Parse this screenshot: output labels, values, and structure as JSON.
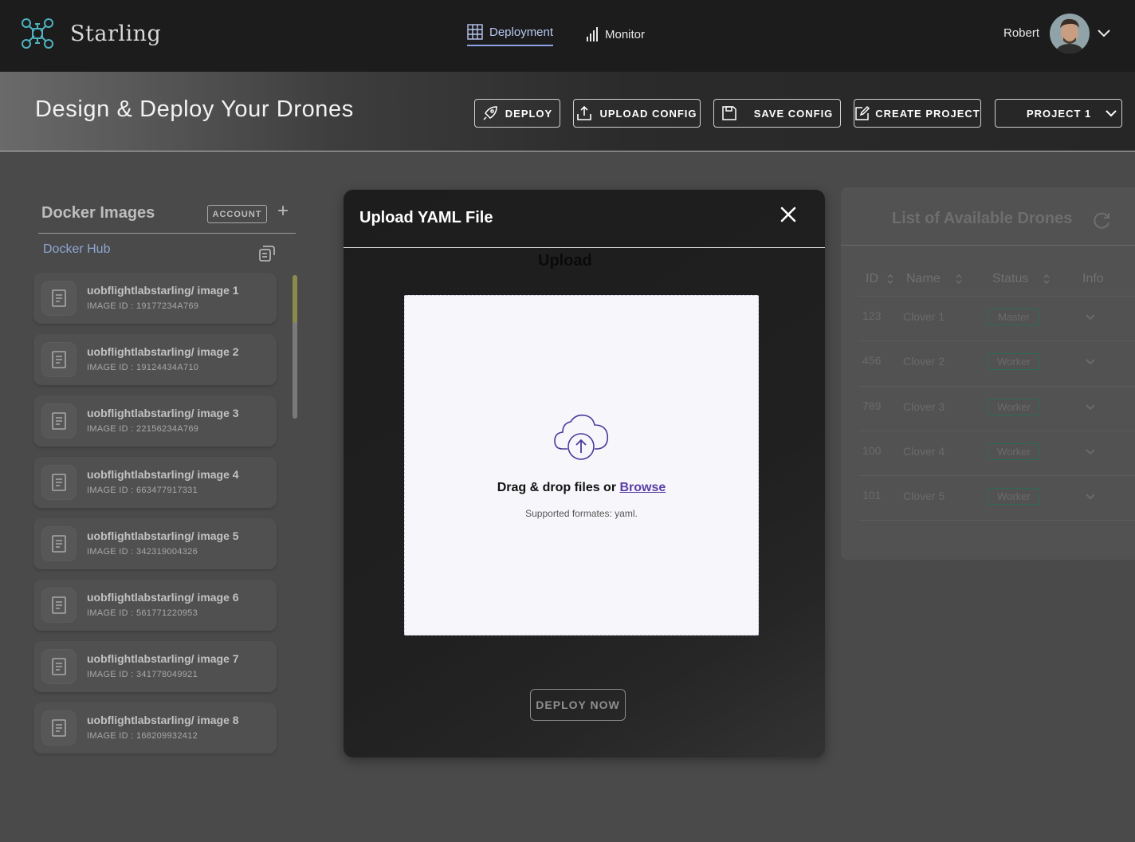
{
  "app": {
    "brand": "Starling"
  },
  "nav": {
    "deployment": "Deployment",
    "monitor": "Monitor"
  },
  "user": {
    "name": "Robert"
  },
  "header": {
    "title": "Design & Deploy Your Drones",
    "deploy": "DEPLOY",
    "upload_config": "UPLOAD CONFIG",
    "save_config": "SAVE CONFIG",
    "create_project": "CREATE PROJECT",
    "project_select": "PROJECT 1"
  },
  "docker": {
    "title": "Docker Images",
    "account": "ACCOUNT",
    "hub": "Docker Hub",
    "images": [
      {
        "name": "uobflightlabstarling/ image 1",
        "id": "IMAGE ID : 19177234A769"
      },
      {
        "name": "uobflightlabstarling/ image 2",
        "id": "IMAGE ID : 19124434A710"
      },
      {
        "name": "uobflightlabstarling/ image 3",
        "id": "IMAGE ID : 22156234A769"
      },
      {
        "name": "uobflightlabstarling/ image 4",
        "id": "IMAGE ID : 663477917331"
      },
      {
        "name": "uobflightlabstarling/ image 5",
        "id": "IMAGE ID : 342319004326"
      },
      {
        "name": "uobflightlabstarling/ image 6",
        "id": "IMAGE ID : 561771220953"
      },
      {
        "name": "uobflightlabstarling/ image 7",
        "id": "IMAGE ID : 341778049921"
      },
      {
        "name": "uobflightlabstarling/ image 8",
        "id": "IMAGE ID : 168209932412"
      }
    ]
  },
  "drones": {
    "title": "List of Available Drones",
    "columns": {
      "id": "ID",
      "name": "Name",
      "status": "Status",
      "info": "Info"
    },
    "rows": [
      {
        "id": "123",
        "name": "Clover 1",
        "status": "Master"
      },
      {
        "id": "456",
        "name": "Clover 2",
        "status": "Worker"
      },
      {
        "id": "789",
        "name": "Clover 3",
        "status": "Worker"
      },
      {
        "id": "100",
        "name": "Clover 4",
        "status": "Worker"
      },
      {
        "id": "101",
        "name": "Clover 5",
        "status": "Worker"
      }
    ]
  },
  "modal": {
    "title": "Upload YAML File",
    "upload_label": "Upload",
    "drag_text": "Drag & drop files or ",
    "browse": "Browse",
    "supported": "Supported formates:  yaml.",
    "deploy_now": "DEPLOY NOW"
  }
}
